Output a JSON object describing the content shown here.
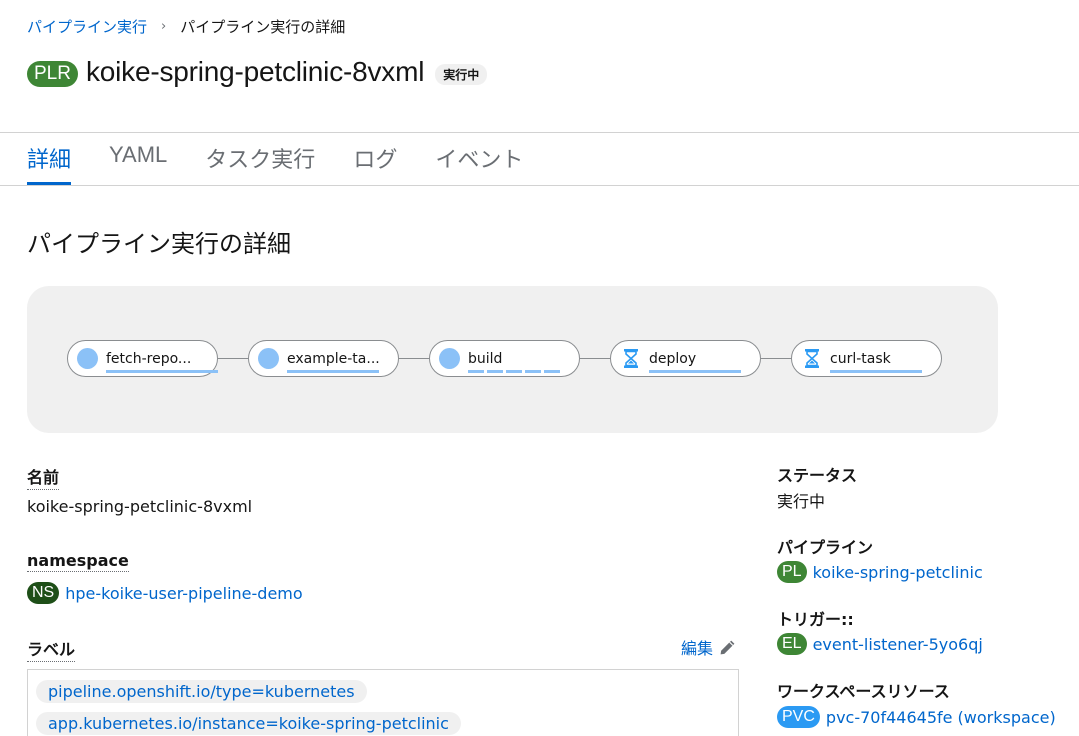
{
  "breadcrumb": {
    "parent": "パイプライン実行",
    "separator": "›",
    "current": "パイプライン実行の詳細"
  },
  "header": {
    "resource_badge": "PLR",
    "title": "koike-spring-petclinic-8vxml",
    "status": "実行中"
  },
  "tabs": [
    {
      "label": "詳細",
      "active": true
    },
    {
      "label": "YAML",
      "active": false
    },
    {
      "label": "タスク実行",
      "active": false
    },
    {
      "label": "ログ",
      "active": false
    },
    {
      "label": "イベント",
      "active": false
    }
  ],
  "section_title": "パイプライン実行の詳細",
  "pipeline_tasks": [
    {
      "name": "fetch-repo...",
      "icon": "running-dot-icon"
    },
    {
      "name": "example-ta...",
      "icon": "running-dot-icon"
    },
    {
      "name": "build",
      "icon": "running-dot-icon"
    },
    {
      "name": "deploy",
      "icon": "hourglass-icon"
    },
    {
      "name": "curl-task",
      "icon": "hourglass-icon"
    }
  ],
  "colors": {
    "running": "#8bc1f7",
    "pending_icon": "#2b9af3",
    "link": "#0066cc",
    "plr_badge": "#3e8635",
    "ns_badge": "#1e4f18",
    "pvc_badge": "#2b9af3"
  },
  "details": {
    "name_label": "名前",
    "name_value": "koike-spring-petclinic-8vxml",
    "namespace_label": "namespace",
    "namespace_badge": "NS",
    "namespace_value": "hpe-koike-user-pipeline-demo",
    "labels_label": "ラベル",
    "edit_label": "編集",
    "labels": [
      "pipeline.openshift.io/type=kubernetes",
      "app.kubernetes.io/instance=koike-spring-petclinic"
    ]
  },
  "side": {
    "status_label": "ステータス",
    "status_value": "実行中",
    "pipeline_label": "パイプライン",
    "pipeline_badge": "PL",
    "pipeline_value": "koike-spring-petclinic",
    "trigger_label": "トリガー::",
    "trigger_badge": "EL",
    "trigger_value": "event-listener-5yo6qj",
    "workspace_label": "ワークスペースリソース",
    "workspace_badge": "PVC",
    "workspace_value": "pvc-70f44645fe (workspace)"
  }
}
